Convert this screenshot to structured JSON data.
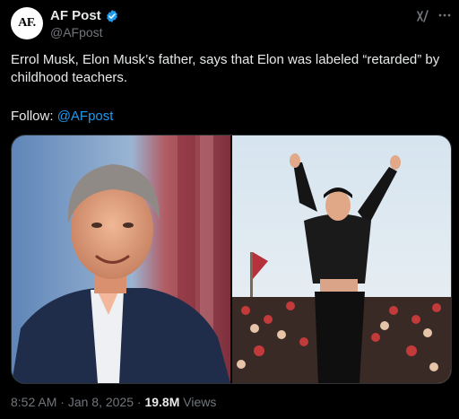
{
  "author": {
    "avatar_text": "AF.",
    "display_name": "AF Post",
    "handle": "@AFpost",
    "verified": true
  },
  "header_icons": [
    "grok-icon",
    "more-options-icon"
  ],
  "tweet": {
    "text": "Errol Musk, Elon Musk’s father, says that Elon was labeled “retarded” by childhood teachers.",
    "follow_label": "Follow: ",
    "follow_handle": "@AFpost"
  },
  "media": {
    "images": [
      {
        "name": "photo-errol-musk"
      },
      {
        "name": "photo-elon-musk-rally"
      }
    ]
  },
  "meta": {
    "time": "8:52 AM",
    "date": "Jan 8, 2025",
    "separator": " · ",
    "views_count": "19.8M",
    "views_label": " Views"
  },
  "colors": {
    "background": "#000000",
    "text": "#e7e9ea",
    "muted": "#71767b",
    "accent": "#1d9bf0"
  }
}
